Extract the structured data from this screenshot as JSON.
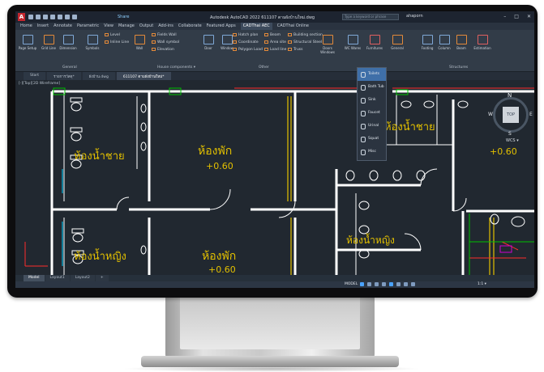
{
  "app": {
    "logo": "A",
    "share_label": "Share",
    "document_title": "Autodesk AutoCAD 2022   611107 ตามผังบ้านใหม่.dwg",
    "search_placeholder": "Type a keyword or phrase",
    "user_name": "ahaporn",
    "window_buttons": [
      "–",
      "□",
      "✕"
    ]
  },
  "menu": {
    "items": [
      "Home",
      "Insert",
      "Annotate",
      "Parametric",
      "View",
      "Manage",
      "Output",
      "Add-ins",
      "Collaborate",
      "Featured Apps",
      "CADThai AEC",
      "CADThai Online"
    ],
    "active_index": 10
  },
  "ribbon": {
    "tools": [
      {
        "label": "Page Setup",
        "icon": "page-setup-icon"
      },
      {
        "label": "Grid Line",
        "icon": "grid-line-icon"
      },
      {
        "label": "Dimension",
        "icon": "dimension-icon"
      },
      {
        "label": "Symbols",
        "icon": "symbols-icon"
      },
      {
        "label": "Wall",
        "icon": "wall-icon"
      },
      {
        "label": "Door",
        "icon": "door-icon"
      },
      {
        "label": "Window",
        "icon": "window-icon"
      },
      {
        "label": "Doors Windows",
        "icon": "doors-windows-icon"
      },
      {
        "label": "WC Wares",
        "icon": "wc-wares-icon"
      },
      {
        "label": "Furnitures",
        "icon": "furniture-icon"
      },
      {
        "label": "General",
        "icon": "general-icon"
      },
      {
        "label": "Footing",
        "icon": "footing-icon"
      },
      {
        "label": "Column",
        "icon": "column-icon"
      },
      {
        "label": "Beam",
        "icon": "beam-icon"
      },
      {
        "label": "Estimation",
        "icon": "estimation-icon"
      }
    ],
    "small_col1": [
      "Level",
      "Inline Line"
    ],
    "small_col2": [
      "Fields Wall",
      "Wall symbol",
      "Elevation"
    ],
    "small_col3": [
      "Hatch plan",
      "Coordinate",
      "Polygon Load"
    ],
    "small_col4": [
      "Beam",
      "Area site",
      "Load line"
    ],
    "small_col5": [
      "Building section",
      "Structural Steel",
      "Truss"
    ],
    "panels": [
      "General",
      "House components ▾",
      "Other",
      "Structures"
    ]
  },
  "doc_tabs": {
    "items": [
      "Start",
      "รายการวัสดุ*",
      "ผังบ้าน.dwg",
      "611107 ตามผังบ้านใหม่*"
    ],
    "active_index": 3
  },
  "viewport": {
    "label": "[-][Top][2D Wireframe]",
    "controls": [
      "–",
      "□",
      "✕"
    ]
  },
  "viewcube": {
    "n": "N",
    "s": "S",
    "w": "W",
    "e": "E",
    "top": "TOP",
    "wcs": "WCS ▾"
  },
  "dropdown": {
    "items": [
      "Toilets",
      "Bath Tub",
      "Sink",
      "Faucet",
      "Urinal",
      "Squat",
      "Misc"
    ],
    "selected_index": 0
  },
  "drawing": {
    "room_labels": [
      {
        "id": "room-men-left",
        "text": "ห้องน้ำชาย"
      },
      {
        "id": "room-women-left",
        "text": "ห้องน้ำหญิง"
      },
      {
        "id": "room-rest-top",
        "text": "ห้องพัก"
      },
      {
        "id": "room-rest-bottom",
        "text": "ห้องพัก"
      },
      {
        "id": "room-men-right",
        "text": "ห้องน้ำชาย"
      },
      {
        "id": "room-women-right",
        "text": "ห้องน้ำหญิง"
      }
    ],
    "levels": [
      {
        "id": "level-top",
        "text": "+0.60"
      },
      {
        "id": "level-bottom",
        "text": "+0.60"
      },
      {
        "id": "level-right",
        "text": "+0.60"
      }
    ],
    "colors": {
      "background": "#212830",
      "wall": "#ffffff",
      "fixture": "#ffffff",
      "gold": "#e3c000",
      "red": "#ff2b2b",
      "green": "#00c000",
      "magenta": "#d000d0",
      "cyan": "#00d0ff"
    }
  },
  "layout_tabs": {
    "items": [
      "Model",
      "Layout1",
      "Layout2",
      "+"
    ],
    "active_index": 0
  },
  "status": {
    "mode": "MODEL",
    "scale": "1:1 ▾"
  },
  "accent": "#3f6fa8"
}
